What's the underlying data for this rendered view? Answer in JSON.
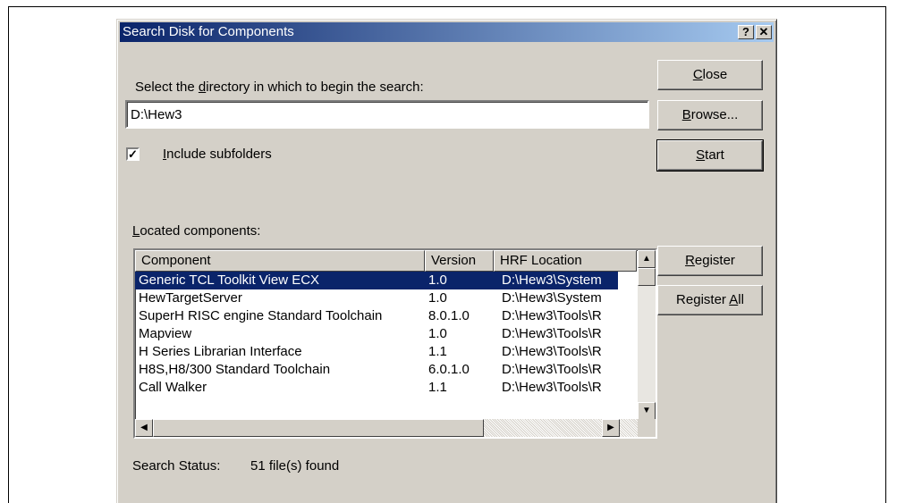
{
  "window": {
    "title": "Search Disk for Components",
    "help_label": "?",
    "close_label": "✕"
  },
  "directory": {
    "prompt_pre": "Select the ",
    "prompt_mnemonic": "d",
    "prompt_post": "irectory in which to begin the search:",
    "value": "D:\\Hew3"
  },
  "subfolders": {
    "checked": true,
    "check_mark": "✓",
    "label_mnemonic": "I",
    "label_rest": "nclude subfolders"
  },
  "buttons": {
    "close": {
      "mn": "C",
      "rest": "lose"
    },
    "browse": {
      "mn": "B",
      "rest": "rowse..."
    },
    "start": {
      "mn": "S",
      "rest": "tart"
    },
    "register": {
      "mn": "R",
      "rest": "egister"
    },
    "register_all": {
      "pre": "Register ",
      "mn": "A",
      "rest": "ll"
    }
  },
  "located": {
    "label_mnemonic": "L",
    "label_rest": "ocated components:",
    "columns": [
      "Component",
      "Version",
      "HRF Location"
    ],
    "rows": [
      [
        "Generic TCL Toolkit View ECX",
        "1.0",
        "D:\\Hew3\\System"
      ],
      [
        "HewTargetServer",
        "1.0",
        "D:\\Hew3\\System"
      ],
      [
        "SuperH RISC engine Standard Toolchain",
        "8.0.1.0",
        "D:\\Hew3\\Tools\\R"
      ],
      [
        "Mapview",
        "1.0",
        "D:\\Hew3\\Tools\\R"
      ],
      [
        "H Series Librarian Interface",
        "1.1",
        "D:\\Hew3\\Tools\\R"
      ],
      [
        "H8S,H8/300 Standard Toolchain",
        "6.0.1.0",
        "D:\\Hew3\\Tools\\R"
      ],
      [
        "Call Walker",
        "1.1",
        "D:\\Hew3\\Tools\\R"
      ]
    ],
    "selected_row": 0
  },
  "scroll": {
    "up": "▲",
    "down": "▼",
    "left": "◀",
    "right": "▶"
  },
  "status": {
    "label": "Search Status:",
    "value": "51 file(s) found"
  }
}
